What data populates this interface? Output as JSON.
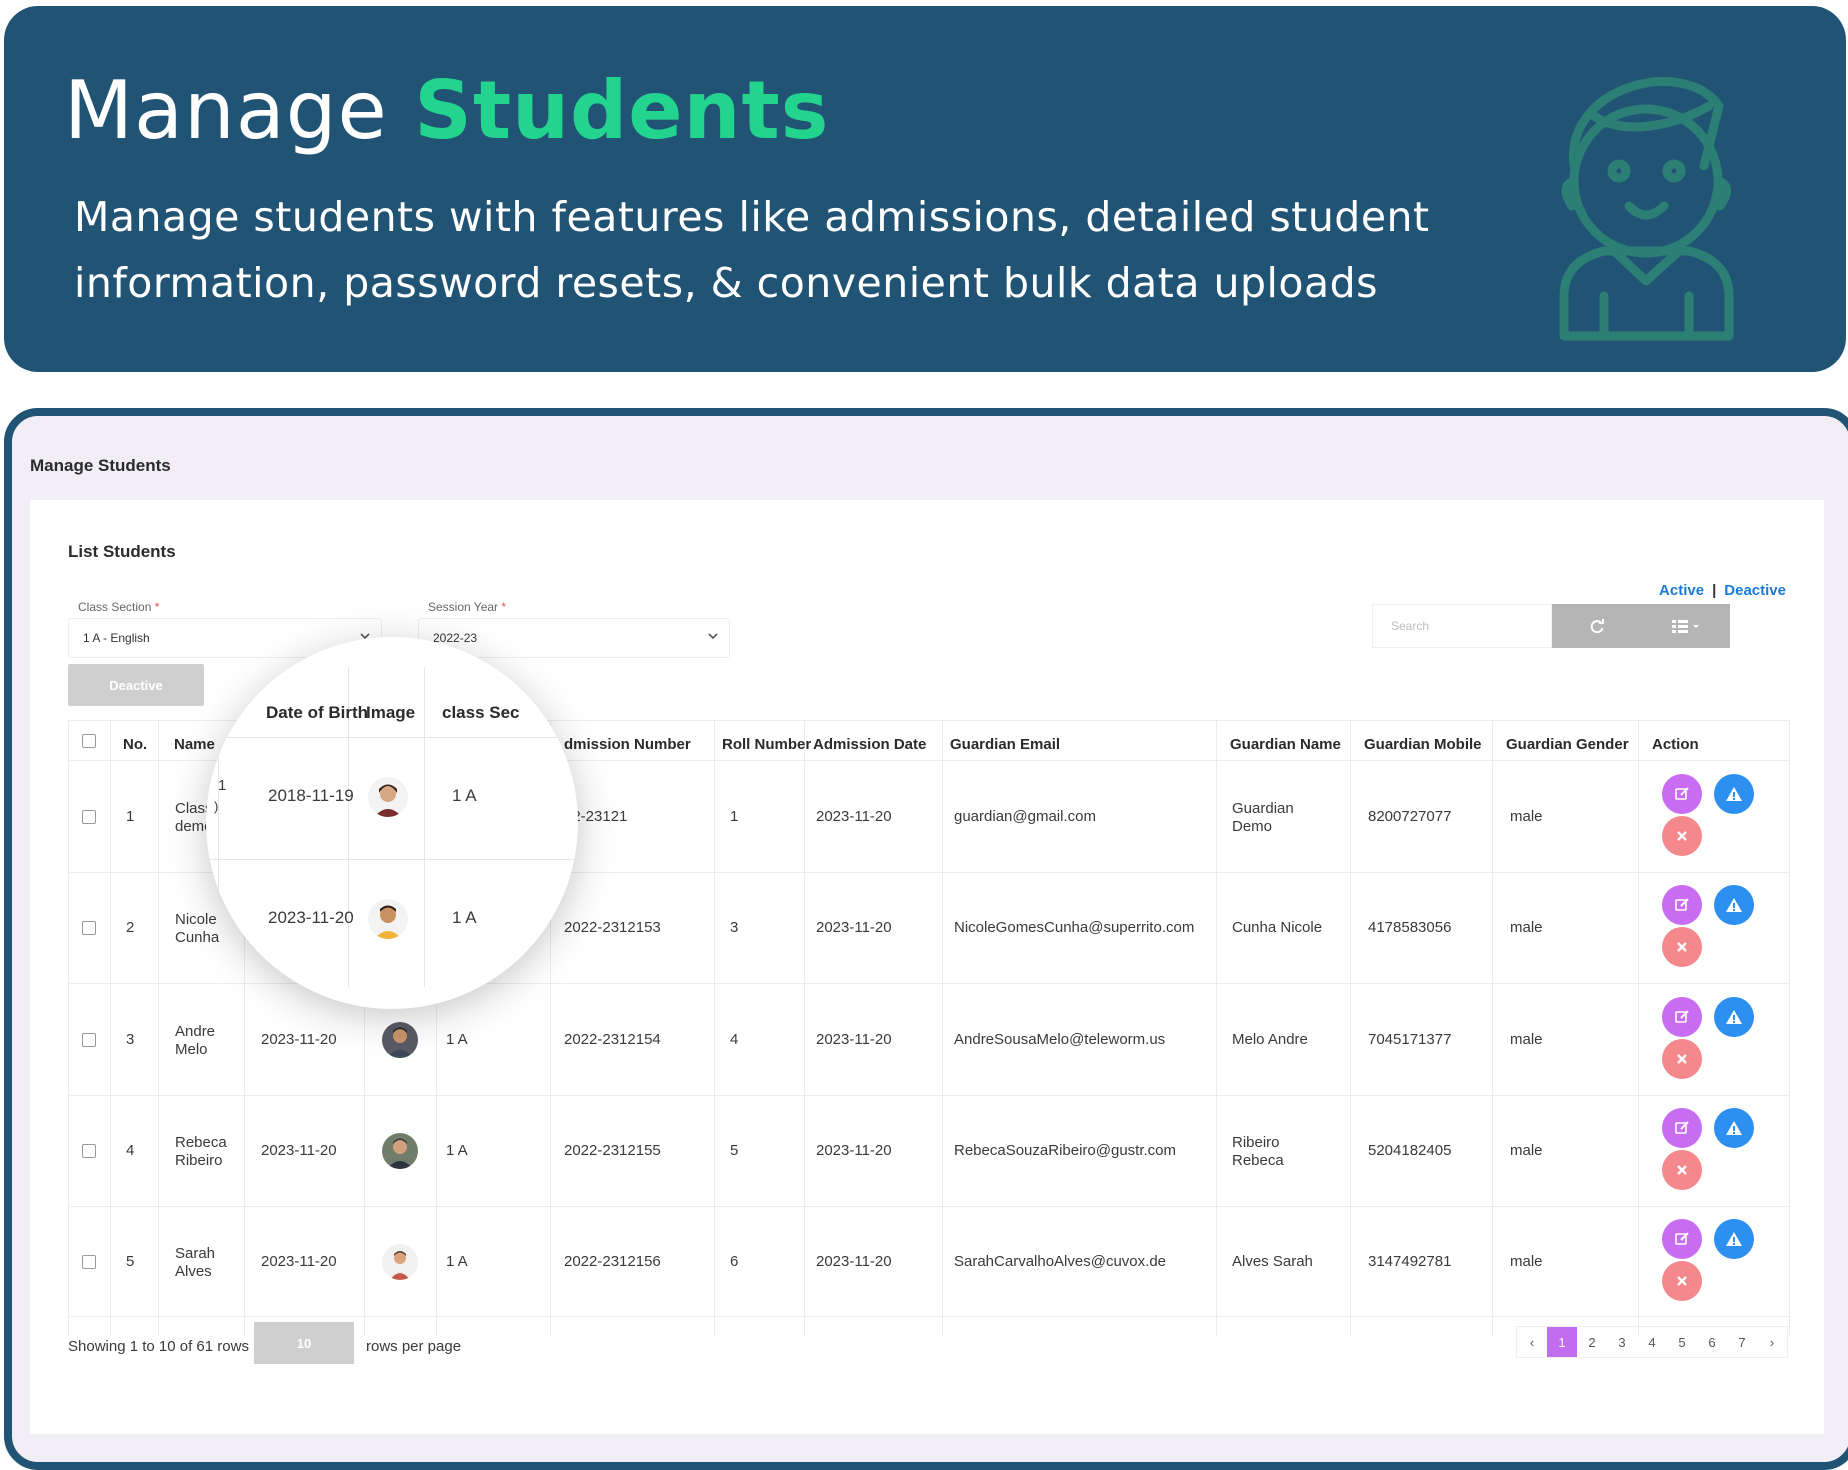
{
  "banner": {
    "title_plain": "Manage",
    "title_accent": "Students",
    "subtitle": "Manage students with features like admissions, detailed student information, password resets, & convenient bulk data uploads"
  },
  "app": {
    "page_title": "Manage Students",
    "card_title": "List Students",
    "class_section_label": "Class Section",
    "class_section_value": "1 A - English",
    "session_year_label": "Session Year",
    "session_year_value": "2022-23",
    "required_mark": "*",
    "status_active": "Active",
    "status_separator": "|",
    "status_deactive": "Deactive",
    "search_placeholder": "Search",
    "deactive_button": "Deactive"
  },
  "table": {
    "headers": {
      "no": "No.",
      "name": "Name",
      "admission_number": "dmission Number",
      "roll_number": "Roll Number",
      "admission_date": "Admission Date",
      "guardian_email": "Guardian Email",
      "guardian_name": "Guardian Name",
      "guardian_mobile": "Guardian Mobile",
      "guardian_gender": "Guardian Gender",
      "action": "Action"
    },
    "rows": [
      {
        "no": "1",
        "name": "Class demo",
        "dob": "2018-11-19",
        "class_section": "1 A",
        "admission_number": "22-23121",
        "roll_number": "1",
        "admission_date": "2023-11-20",
        "guardian_email": "guardian@gmail.com",
        "guardian_name": "Guardian Demo",
        "guardian_mobile": "8200727077",
        "guardian_gender": "male"
      },
      {
        "no": "2",
        "name": "Nicole Cunha",
        "dob": "2023-11-20",
        "class_section": "1 A",
        "admission_number": "2022-2312153",
        "roll_number": "3",
        "admission_date": "2023-11-20",
        "guardian_email": "NicoleGomesCunha@superrito.com",
        "guardian_name": "Cunha Nicole",
        "guardian_mobile": "4178583056",
        "guardian_gender": "male"
      },
      {
        "no": "3",
        "name": "Andre Melo",
        "dob": "2023-11-20",
        "class_section": "1 A",
        "admission_number": "2022-2312154",
        "roll_number": "4",
        "admission_date": "2023-11-20",
        "guardian_email": "AndreSousaMelo@teleworm.us",
        "guardian_name": "Melo Andre",
        "guardian_mobile": "7045171377",
        "guardian_gender": "male"
      },
      {
        "no": "4",
        "name": "Rebeca Ribeiro",
        "dob": "2023-11-20",
        "class_section": "1 A",
        "admission_number": "2022-2312155",
        "roll_number": "5",
        "admission_date": "2023-11-20",
        "guardian_email": "RebecaSouzaRibeiro@gustr.com",
        "guardian_name": "Ribeiro Rebeca",
        "guardian_mobile": "5204182405",
        "guardian_gender": "male"
      },
      {
        "no": "5",
        "name": "Sarah Alves",
        "dob": "2023-11-20",
        "class_section": "1 A",
        "admission_number": "2022-2312156",
        "roll_number": "6",
        "admission_date": "2023-11-20",
        "guardian_email": "SarahCarvalhoAlves@cuvox.de",
        "guardian_name": "Alves Sarah",
        "guardian_mobile": "3147492781",
        "guardian_gender": "male"
      }
    ]
  },
  "magnifier": {
    "headers": {
      "dob": "Date of Birth",
      "image": "Image",
      "class_section": "class Sec"
    },
    "row_fragment_1": "1",
    "row_fragment_2": ")"
  },
  "footer": {
    "showing": "Showing 1 to 10 of 61 rows",
    "rows_per_page_value": "10",
    "rows_per_page_label": "rows per page",
    "pages": [
      "‹",
      "1",
      "2",
      "3",
      "4",
      "5",
      "6",
      "7",
      "›"
    ],
    "active_page": "1"
  },
  "icons": {
    "header_illustration": "student-outline-icon",
    "select_chevron": "chevron-down-icon",
    "refresh": "refresh-icon",
    "columns": "list-grid-icon",
    "edit": "edit-icon",
    "warning": "warning-icon",
    "delete": "close-icon"
  },
  "colors": {
    "banner_bg": "#215474",
    "accent_green": "#22d48e",
    "link_blue": "#1b7ad6",
    "edit_purple": "#c86df2",
    "warn_blue": "#2d8ff0",
    "delete_pink": "#f5888d",
    "pager_active": "#c26df0"
  }
}
